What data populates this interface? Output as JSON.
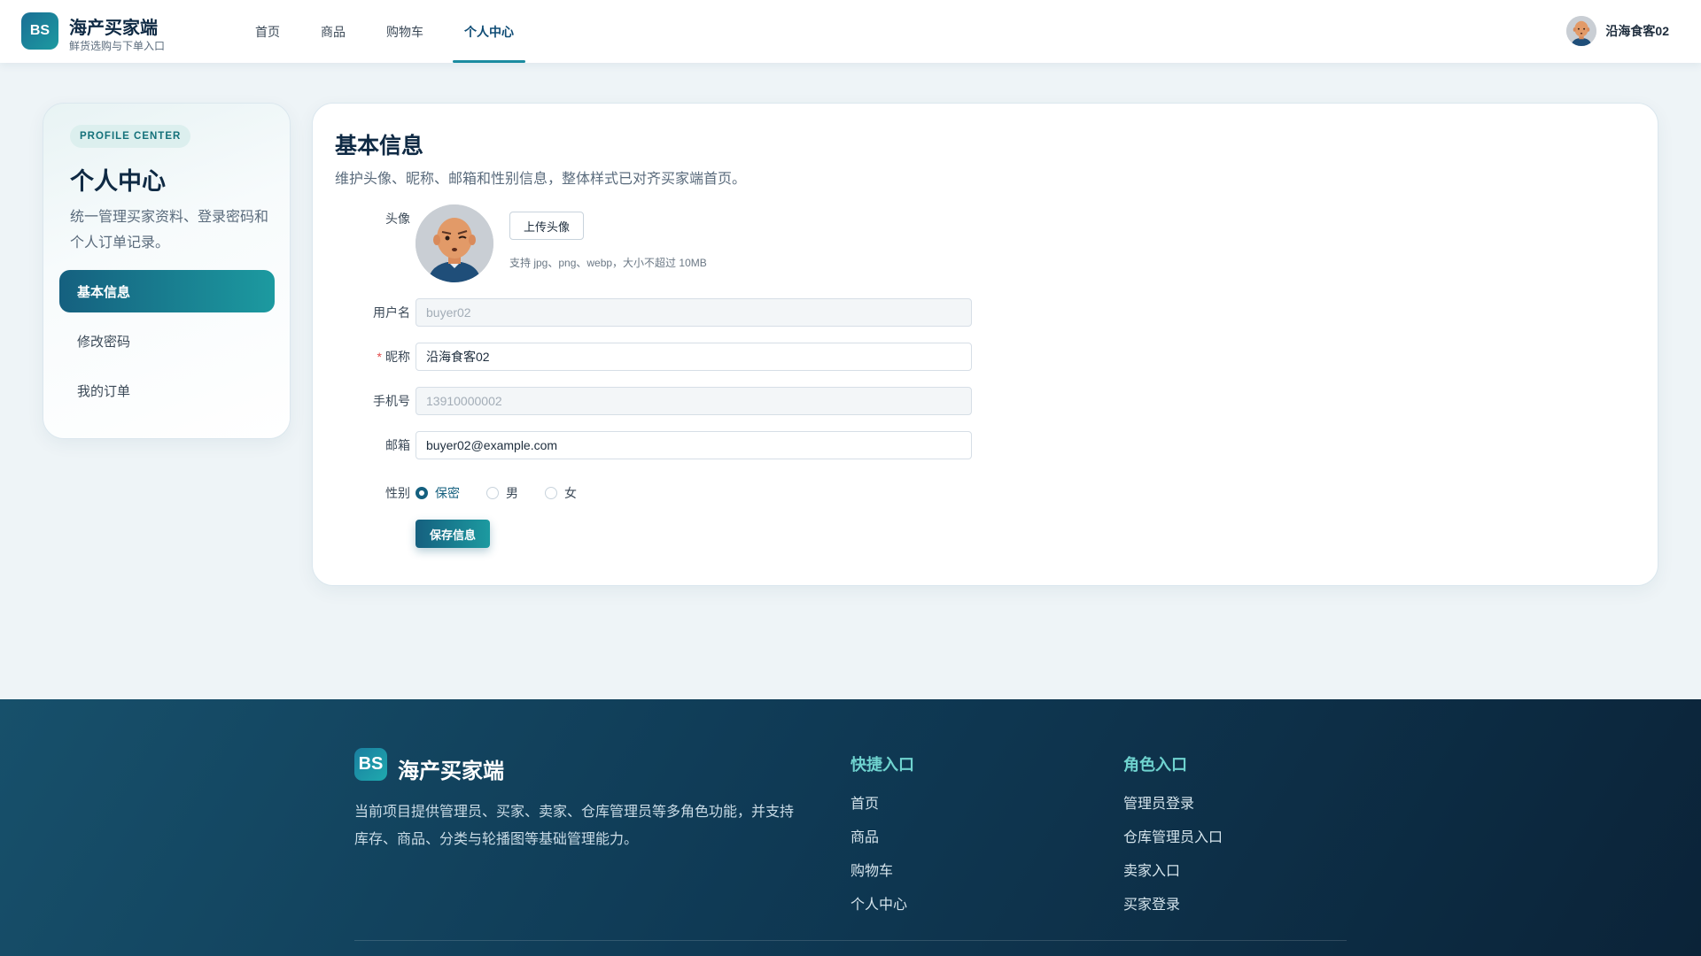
{
  "header": {
    "logo_text": "BS",
    "brand_title": "海产买家端",
    "brand_sub": "鲜货选购与下单入口",
    "nav": [
      {
        "label": "首页",
        "active": false
      },
      {
        "label": "商品",
        "active": false
      },
      {
        "label": "购物车",
        "active": false
      },
      {
        "label": "个人中心",
        "active": true
      }
    ],
    "user_name": "沿海食客02"
  },
  "sidebar": {
    "badge": "PROFILE CENTER",
    "title": "个人中心",
    "desc": "统一管理买家资料、登录密码和个人订单记录。",
    "items": [
      {
        "label": "基本信息",
        "active": true
      },
      {
        "label": "修改密码",
        "active": false
      },
      {
        "label": "我的订单",
        "active": false
      }
    ]
  },
  "main": {
    "title": "基本信息",
    "desc": "维护头像、昵称、邮箱和性别信息，整体样式已对齐买家端首页。",
    "avatar_label": "头像",
    "upload_label": "上传头像",
    "upload_tip": "支持 jpg、png、webp，大小不超过 10MB",
    "username_label": "用户名",
    "username_value": "buyer02",
    "nickname_label": "昵称",
    "nickname_value": "沿海食客02",
    "phone_label": "手机号",
    "phone_value": "13910000002",
    "email_label": "邮箱",
    "email_value": "buyer02@example.com",
    "gender_label": "性别",
    "gender_options": [
      {
        "label": "保密",
        "checked": true
      },
      {
        "label": "男",
        "checked": false
      },
      {
        "label": "女",
        "checked": false
      }
    ],
    "save_label": "保存信息"
  },
  "footer": {
    "logo_text": "BS",
    "brand": "海产买家端",
    "desc": "当前项目提供管理员、买家、卖家、仓库管理员等多角色功能，并支持库存、商品、分类与轮播图等基础管理能力。",
    "quick_title": "快捷入口",
    "quick_links": [
      "首页",
      "商品",
      "购物车",
      "个人中心"
    ],
    "role_title": "角色入口",
    "role_links": [
      "管理员登录",
      "仓库管理员入口",
      "卖家入口",
      "买家登录"
    ]
  },
  "colors": {
    "primary": "#15607f",
    "accent": "#1c9aa0",
    "footer_bg": "#0f3a55",
    "footer_title": "#6fd3cf"
  },
  "icons": [
    "avatar-icon"
  ]
}
